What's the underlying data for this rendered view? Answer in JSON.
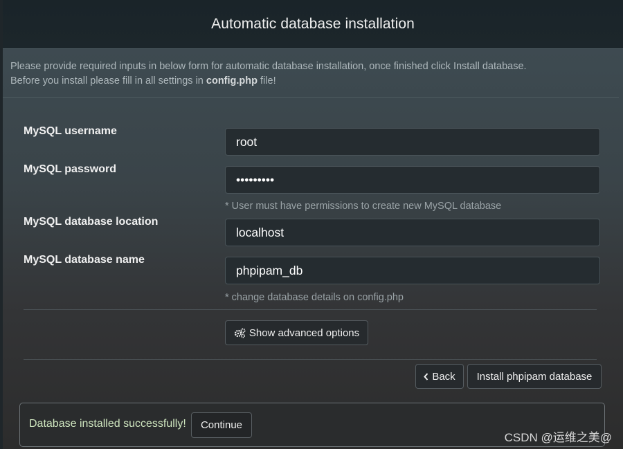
{
  "header": {
    "title": "Automatic database installation"
  },
  "intro": {
    "line1": "Please provide required inputs in below form for automatic database installation, once finished click Install database.",
    "line2_prefix": "Before you install please fill in all settings in ",
    "line2_bold": "config.php",
    "line2_suffix": " file!"
  },
  "form": {
    "username": {
      "label": "MySQL username",
      "value": "root"
    },
    "password": {
      "label": "MySQL password",
      "value": "•••••••••"
    },
    "password_help": "* User must have permissions to create new MySQL database",
    "location": {
      "label": "MySQL database location",
      "value": "localhost"
    },
    "dbname": {
      "label": "MySQL database name",
      "value": "phpipam_db"
    },
    "dbname_help": "* change database details on config.php"
  },
  "buttons": {
    "advanced": "Show advanced options",
    "back": "Back",
    "install": "Install phpipam database",
    "back_icon": "chevron-left-icon",
    "advanced_icon": "gears-icon"
  },
  "success": {
    "message": "Database installed successfully!",
    "continue": "Continue"
  },
  "watermark": "CSDN @运维之美@"
}
